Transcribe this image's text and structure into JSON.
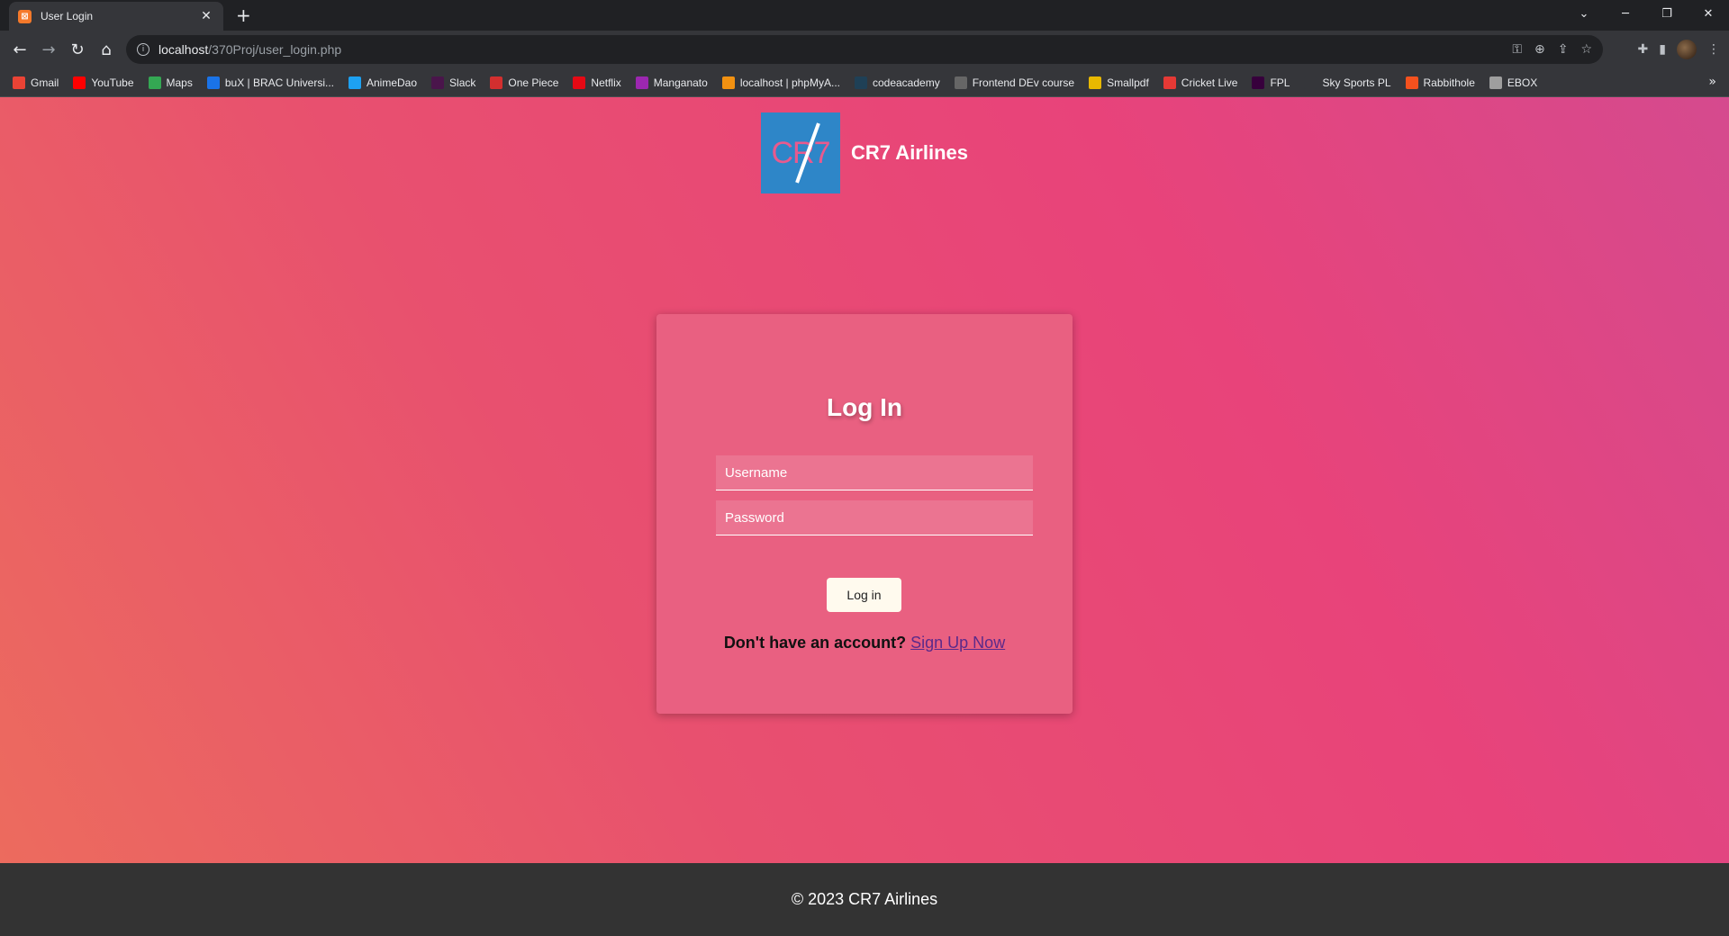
{
  "browser": {
    "tab_title": "User Login",
    "tab_favicon": "xampp-icon",
    "url_host": "localhost",
    "url_path": "/370Proj/user_login.php",
    "bookmarks": [
      {
        "label": "Gmail",
        "color": "#ea4335"
      },
      {
        "label": "YouTube",
        "color": "#ff0000"
      },
      {
        "label": "Maps",
        "color": "#34a853"
      },
      {
        "label": "buX | BRAC Universi...",
        "color": "#1a73e8"
      },
      {
        "label": "AnimeDao",
        "color": "#1da1f2"
      },
      {
        "label": "Slack",
        "color": "#4a154b"
      },
      {
        "label": "One Piece",
        "color": "#d32f2f"
      },
      {
        "label": "Netflix",
        "color": "#e50914"
      },
      {
        "label": "Manganato",
        "color": "#9c27b0"
      },
      {
        "label": "localhost | phpMyA...",
        "color": "#f29111"
      },
      {
        "label": "codeacademy",
        "color": "#1f4056"
      },
      {
        "label": "Frontend DEv course",
        "color": "#666666"
      },
      {
        "label": "Smallpdf",
        "color": "#e8b800"
      },
      {
        "label": "Cricket Live",
        "color": "#e53935"
      },
      {
        "label": "FPL",
        "color": "#37003c"
      },
      {
        "label": "Sky Sports PL",
        "color": "#35363a"
      },
      {
        "label": "Rabbithole",
        "color": "#f4511e"
      },
      {
        "label": "EBOX",
        "color": "#9e9e9e"
      }
    ]
  },
  "header": {
    "logo_text": "CR7",
    "brand": "CR7 Airlines"
  },
  "login": {
    "title": "Log In",
    "username_placeholder": "Username",
    "password_placeholder": "Password",
    "button_label": "Log in",
    "signup_question": "Don't have an account?",
    "signup_link": "Sign Up Now"
  },
  "footer": {
    "text": "© 2023 CR7 Airlines"
  }
}
